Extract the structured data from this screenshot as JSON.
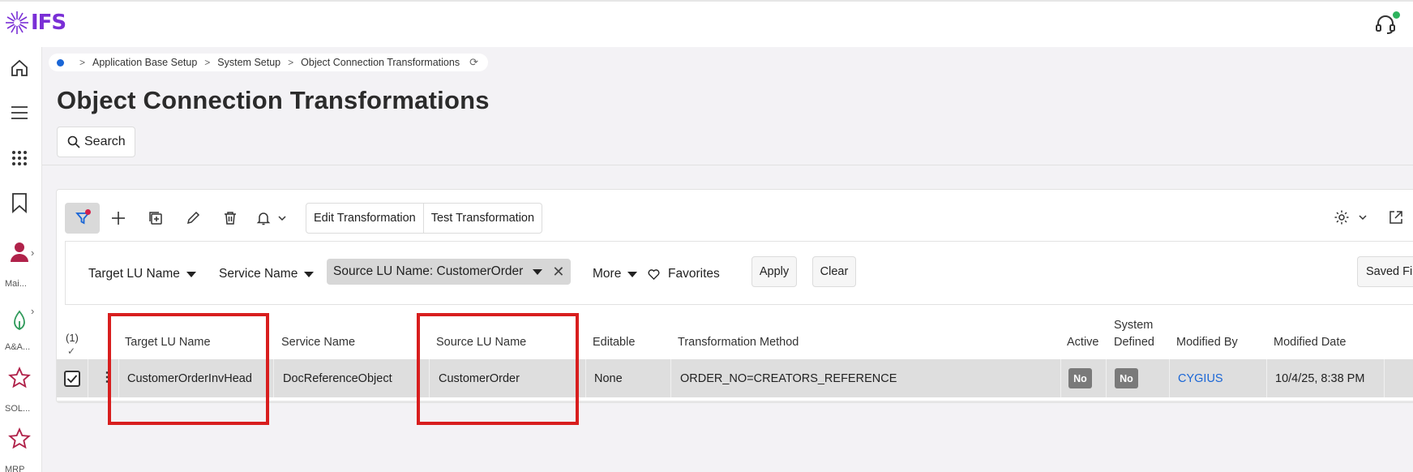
{
  "app": {
    "logo_text": "IFS"
  },
  "sidebar": {
    "items": [
      {
        "icon": "home-icon"
      },
      {
        "icon": "menu-icon"
      },
      {
        "icon": "apps-grid-icon"
      },
      {
        "icon": "bookmark-icon"
      },
      {
        "icon": "person-icon",
        "label": "Mai..."
      },
      {
        "icon": "leaf-icon",
        "label": "A&A..."
      },
      {
        "icon": "star-icon",
        "label": "SOL..."
      },
      {
        "icon": "star-icon",
        "label": "MRP"
      }
    ]
  },
  "breadcrumb": {
    "items": [
      "Application Base Setup",
      "System Setup",
      "Object Connection Transformations"
    ]
  },
  "page": {
    "title": "Object Connection Transformations",
    "search_label": "Search"
  },
  "toolbar": {
    "edit_transformation": "Edit Transformation",
    "test_transformation": "Test Transformation"
  },
  "filters": {
    "target_lu": "Target LU Name",
    "service": "Service Name",
    "source_lu_chip": "Source LU Name: CustomerOrder",
    "more": "More",
    "favorites": "Favorites",
    "apply": "Apply",
    "clear": "Clear",
    "saved_filters": "Saved Fil"
  },
  "table": {
    "selection_count": "(1)",
    "columns": {
      "target_lu": "Target LU Name",
      "service": "Service Name",
      "source_lu": "Source LU Name",
      "editable": "Editable",
      "method": "Transformation Method",
      "active": "Active",
      "system_defined_1": "System",
      "system_defined_2": "Defined",
      "modified_by": "Modified By",
      "modified_date": "Modified Date"
    },
    "rows": [
      {
        "target_lu": "CustomerOrderInvHead",
        "service": "DocReferenceObject",
        "source_lu": "CustomerOrder",
        "editable": "None",
        "method": "ORDER_NO=CREATORS_REFERENCE",
        "active": "No",
        "system_defined": "No",
        "modified_by": "CYGIUS",
        "modified_date": "10/4/25, 8:38 PM"
      }
    ]
  },
  "colors": {
    "accent": "#1a66d6",
    "highlight": "#d81e1e",
    "brand": "#7a2fd6"
  }
}
